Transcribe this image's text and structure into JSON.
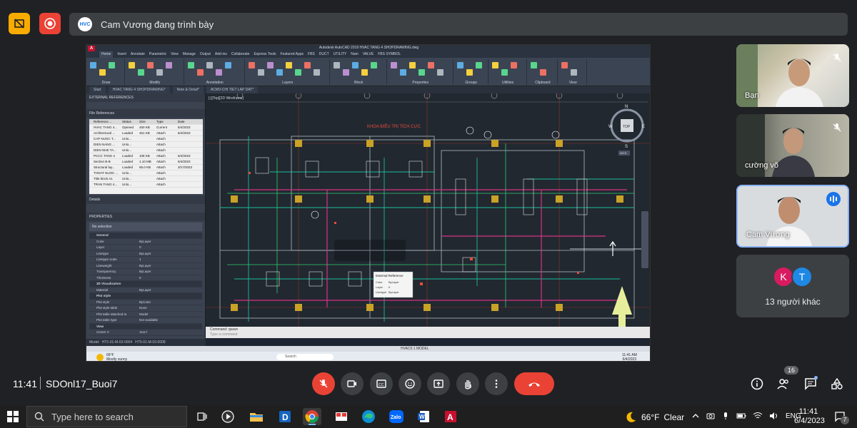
{
  "meet": {
    "presenter_logo": "HVC",
    "presenter_text": "Cam Vương đang trình bày",
    "time": "11:41",
    "meeting_code": "SDOnl17_Buoi7",
    "participant_count": "16"
  },
  "participants": [
    {
      "name": "Bạn",
      "mic": "off"
    },
    {
      "name": "cường võ",
      "mic": "off"
    },
    {
      "name": "Cam Vương",
      "mic": "speaking"
    }
  ],
  "others": {
    "avatars": [
      {
        "letter": "K",
        "color": "#d81b60"
      },
      {
        "letter": "T",
        "color": "#1e88e5"
      }
    ],
    "label": "13 người khác"
  },
  "autocad": {
    "title": "Autodesk AutoCAD 2019   HVAC TANG 4 SHOPDRAWING.dwg",
    "logo": "A",
    "menu_tabs": [
      "Home",
      "Insert",
      "Annotate",
      "Parametric",
      "View",
      "Manage",
      "Output",
      "Add-ins",
      "Collaborate",
      "Express Tools",
      "Featured Apps",
      "FBS",
      "DUCT",
      "UTILITY",
      "Nam",
      "VALVE",
      "FBS SYMBOL"
    ],
    "ribbon_groups": [
      "Draw",
      "Modify",
      "Annotation",
      "Layers",
      "Block",
      "Properties",
      "Groups",
      "Utilities",
      "Clipboard",
      "View"
    ],
    "doc_tabs": [
      "Start",
      "HVAC TANG 4 SHOPDRAWING*",
      "Note & Detail*",
      "ACMV-CHI TIET LAP DAT*"
    ],
    "panel_title": "EXTERNAL REFERENCES",
    "file_ref_title": "File References",
    "file_ref_headers": [
      "Reference ...",
      "Status",
      "Size",
      "Type",
      "Date"
    ],
    "file_refs": [
      [
        "HVAC TANG 4...",
        "Opened",
        "450 KB",
        "Current",
        "6/4/2023"
      ],
      [
        "Architectural ...",
        "Loaded",
        "451 KB",
        "Attach",
        "6/4/2023"
      ],
      [
        "CAP NUOC T...",
        "Unlo...",
        "",
        "Attach",
        ""
      ],
      [
        "DIEN NANG ...",
        "Unlo...",
        "",
        "Attach",
        ""
      ],
      [
        "DIEN NHE TA...",
        "Unlo...",
        "",
        "Attach",
        ""
      ],
      [
        "PCCC TANG 4",
        "Loaded",
        "108 KB",
        "Attach",
        "6/4/2023"
      ],
      [
        "Section B-B",
        "Loaded",
        "1.10 MB",
        "Attach",
        "6/4/2023"
      ],
      [
        "Structural lay...",
        "Loaded",
        "65.0 KB",
        "Attach",
        "3/17/2023"
      ],
      [
        "THOAT NUOC ...",
        "Unlo...",
        "",
        "Attach",
        ""
      ],
      [
        "Title block A1",
        "Unlo...",
        "",
        "Attach",
        ""
      ],
      [
        "TRAN TANG 4...",
        "Unlo...",
        "",
        "Attach",
        ""
      ]
    ],
    "details_label": "Details",
    "properties_title": "PROPERTIES",
    "selection": "No selection",
    "properties": [
      [
        "General",
        ""
      ],
      [
        "Color",
        "ByLayer"
      ],
      [
        "Layer",
        "0"
      ],
      [
        "Linetype",
        "ByLayer"
      ],
      [
        "Linetype scale",
        "1"
      ],
      [
        "Lineweight",
        "ByLayer"
      ],
      [
        "Transparency",
        "ByLayer"
      ],
      [
        "Thickness",
        "0"
      ],
      [
        "3D Visualization",
        ""
      ],
      [
        "Material",
        "ByLayer"
      ],
      [
        "Plot style",
        ""
      ],
      [
        "Plot style",
        "ByColor"
      ],
      [
        "Plot style table",
        "None"
      ],
      [
        "Plot table attached to",
        "Model"
      ],
      [
        "Plot table type",
        "Not available"
      ],
      [
        "View",
        ""
      ],
      [
        "Center X",
        "11117"
      ]
    ],
    "model_tabs": [
      "Model",
      "HT5-01-M-03-0004",
      "HT5-01-M-03-0008"
    ],
    "viewport_label": "[-][Top][2D Wireframe]",
    "room_label": "KHOA ĐIỀU TRỊ TÍCH CỰC",
    "viewcube": {
      "n": "N",
      "s": "S",
      "e": "E",
      "w": "W",
      "top": "TOP",
      "wcs": "WCS"
    },
    "tooltip": {
      "title": "External Reference",
      "color": "ByLayer",
      "layer": "0",
      "linetype": "ByLayer",
      "labels": [
        "Color",
        "Layer",
        "Linetype"
      ]
    },
    "command_history": "Command:   qsave",
    "command_placeholder": "Type a command",
    "status_text": "HVAC5:1   MODEL",
    "mini_taskbar": {
      "weather_temp": "66°F",
      "weather_desc": "Mostly sunny",
      "search": "Search",
      "time": "11:41 AM",
      "date": "6/4/2023"
    }
  },
  "taskbar": {
    "search_placeholder": "Type here to search",
    "weather_temp": "66°F",
    "weather_desc": "Clear",
    "language": "ENG",
    "time": "11:41",
    "date": "6/4/2023",
    "notification_count": "7"
  }
}
